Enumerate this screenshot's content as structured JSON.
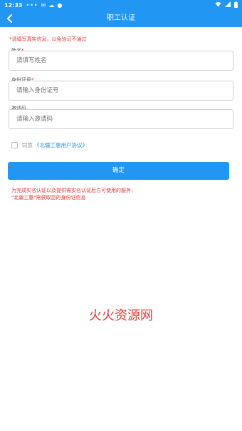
{
  "status_bar": {
    "time": "12:33",
    "dots": "•••",
    "icons": [
      "mail-icon",
      "cloud-icon",
      "notification-icon",
      "wifi-icon",
      "signal-icon",
      "battery-icon"
    ]
  },
  "header": {
    "title": "职工认证",
    "back_icon": "chevron-left-icon",
    "background_color": "#2196f3"
  },
  "notice": "*请填写真实信息，以免验证不通过",
  "form": {
    "name": {
      "label": "姓名",
      "required_mark": "*",
      "placeholder": "请填写姓名"
    },
    "id_number": {
      "label": "身份证号",
      "required_mark": "*",
      "placeholder": "请输入身份证号"
    },
    "invite_code": {
      "label": "邀请码",
      "placeholder": "请输入邀请码"
    }
  },
  "agreement": {
    "prefix": "同意",
    "link": "《北疆工惠用户协议》",
    "checked": false
  },
  "confirm_button": "确定",
  "info_lines": [
    "为完成实名认证以及提供需实名认证后方可使用的服务，",
    "\"北疆工惠\"需获取您的身份证信息"
  ],
  "watermark": "火火资源网",
  "colors": {
    "accent": "#2196f3",
    "warning": "#e53935"
  }
}
